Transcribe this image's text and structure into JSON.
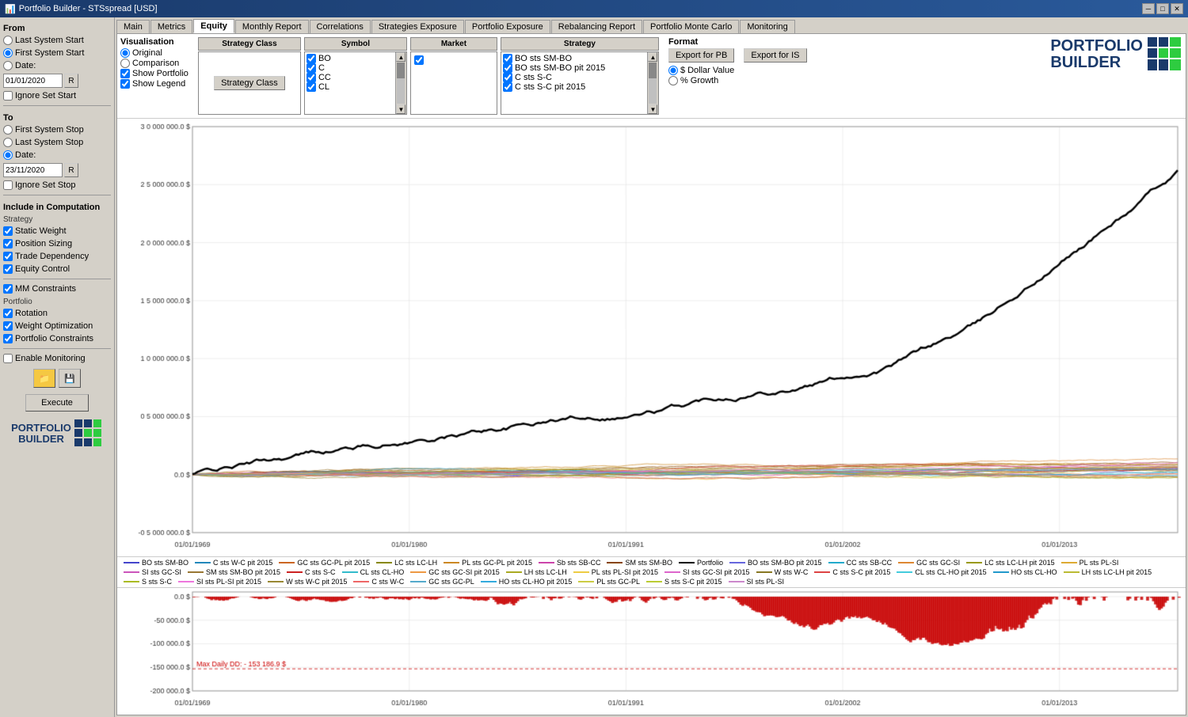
{
  "titleBar": {
    "title": "Portfolio Builder - STSspread [USD]",
    "iconLabel": "pb-icon",
    "controls": [
      "minimize",
      "maximize",
      "close"
    ]
  },
  "tabs": [
    {
      "label": "Main",
      "active": false
    },
    {
      "label": "Metrics",
      "active": false
    },
    {
      "label": "Equity",
      "active": true
    },
    {
      "label": "Monthly Report",
      "active": false
    },
    {
      "label": "Correlations",
      "active": false
    },
    {
      "label": "Strategies Exposure",
      "active": false
    },
    {
      "label": "Portfolio Exposure",
      "active": false
    },
    {
      "label": "Rebalancing Report",
      "active": false
    },
    {
      "label": "Portfolio Monte Carlo",
      "active": false
    },
    {
      "label": "Monitoring",
      "active": false
    }
  ],
  "leftPanel": {
    "fromLabel": "From",
    "fromOptions": [
      {
        "label": "Last System Start",
        "checked": false
      },
      {
        "label": "First System Start",
        "checked": true
      },
      {
        "label": "Date:",
        "checked": false
      }
    ],
    "fromDate": "01/01/2020",
    "ignoreSetStart": "Ignore Set Start",
    "toLabel": "To",
    "toOptions": [
      {
        "label": "First System Stop",
        "checked": false
      },
      {
        "label": "Last System Stop",
        "checked": false
      },
      {
        "label": "Date:",
        "checked": true
      }
    ],
    "toDate": "23/11/2020",
    "ignoreSetStop": "Ignore Set Stop",
    "includeCompLabel": "Include in Computation",
    "strategyLabel": "Strategy",
    "strategyChecks": [
      {
        "label": "Static Weight",
        "checked": true
      },
      {
        "label": "Position Sizing",
        "checked": true
      },
      {
        "label": "Trade Dependency",
        "checked": true
      },
      {
        "label": "Equity Control",
        "checked": true
      }
    ],
    "portfolioLabel": "Portfolio",
    "portfolioChecks": [
      {
        "label": "MM Constraints",
        "checked": true
      },
      {
        "label": "Rotation",
        "checked": true
      },
      {
        "label": "Weight Optimization",
        "checked": true
      },
      {
        "label": "Portfolio Constraints",
        "checked": true
      }
    ],
    "enableMonitoring": "Enable Monitoring",
    "executeLabel": "Execute"
  },
  "visualisation": {
    "title": "Visualisation",
    "radioOptions": [
      {
        "label": "Original",
        "checked": true
      },
      {
        "label": "Comparison",
        "checked": false
      }
    ],
    "checks": [
      {
        "label": "Show Portfolio",
        "checked": true
      },
      {
        "label": "Show Legend",
        "checked": true
      }
    ],
    "strategyClassHeader": "Strategy Class",
    "symbolHeader": "Symbol",
    "symbolItems": [
      "BO",
      "C",
      "CC",
      "CL"
    ],
    "marketHeader": "Market",
    "marketCheck": true,
    "strategyHeader": "Strategy",
    "strategyItems": [
      "BO sts SM-BO",
      "BO sts SM-BO pit 2015",
      "C sts S-C",
      "C sts S-C pit 2015"
    ],
    "format": {
      "title": "Format",
      "options": [
        {
          "label": "$ Dollar Value",
          "checked": true
        },
        {
          "label": "% Growth",
          "checked": false
        }
      ]
    },
    "exportForPB": "Export for PB",
    "exportForIS": "Export for IS"
  },
  "chartYLabels": [
    "3 000 000.0 $",
    "2 500 000.0 $",
    "2 000 000.0 $",
    "1 500 000.0 $",
    "1 000 000.0 $",
    "500 000.0 $",
    "0.0 $",
    "-500 000.0 $"
  ],
  "chartXLabels": [
    "01/01/1969",
    "01/01/1980",
    "01/01/1991",
    "01/01/2002",
    "01/01/2013"
  ],
  "ddYLabels": [
    "0.0 $",
    "-50 000.0 $",
    "-100 000.0 $",
    "-150 000.0 $",
    "-200 000.0 $"
  ],
  "ddXLabels": [
    "01/01/1969",
    "01/01/1980",
    "01/01/1991",
    "01/01/2002",
    "01/01/2013"
  ],
  "maxDailyDD": "Max Daily DD: - 153 186.9 $",
  "legend": [
    {
      "label": "BO sts SM-BO",
      "color": "#4444cc"
    },
    {
      "label": "C sts W-C pit 2015",
      "color": "#2288bb"
    },
    {
      "label": "GC sts GC-PL pit 2015",
      "color": "#cc6622"
    },
    {
      "label": "LC sts LC-LH",
      "color": "#888800"
    },
    {
      "label": "PL sts GC-PL pit 2015",
      "color": "#cc8822"
    },
    {
      "label": "Sb sts SB-CC",
      "color": "#cc44aa"
    },
    {
      "label": "SM sts SM-BO",
      "color": "#884400"
    },
    {
      "label": "Portfolio",
      "color": "#000000"
    },
    {
      "label": "BO sts SM-BO pit 2015",
      "color": "#6666dd"
    },
    {
      "label": "CC sts SB-CC",
      "color": "#22aacc"
    },
    {
      "label": "GC sts GC-SI",
      "color": "#dd8833"
    },
    {
      "label": "LC sts LC-LH pit 2015",
      "color": "#999911"
    },
    {
      "label": "PL sts PL-SI",
      "color": "#ddaa33"
    },
    {
      "label": "SI sts GC-SI",
      "color": "#cc55bb"
    },
    {
      "label": "SM sts SM-BO pit 2015",
      "color": "#997733"
    },
    {
      "label": "C sts S-C",
      "color": "#cc2222"
    },
    {
      "label": "CL sts CL-HO",
      "color": "#33bbcc"
    },
    {
      "label": "GC sts GC-SI pit 2015",
      "color": "#ee9944"
    },
    {
      "label": "LH sts LC-LH",
      "color": "#aaaa22"
    },
    {
      "label": "PL sts PL-SI pit 2015",
      "color": "#eecc44"
    },
    {
      "label": "SI sts GC-SI pit 2015",
      "color": "#dd66cc"
    },
    {
      "label": "W sts W-C",
      "color": "#887722"
    },
    {
      "label": "C sts S-C pit 2015",
      "color": "#dd4444"
    },
    {
      "label": "CL sts CL-HO pit 2015",
      "color": "#44ccdd"
    },
    {
      "label": "HO sts CL-HO",
      "color": "#2299cc"
    },
    {
      "label": "LH sts LC-LH pit 2015",
      "color": "#bbbb33"
    },
    {
      "label": "S sts S-C",
      "color": "#aabb22"
    },
    {
      "label": "SI sts PL-SI pit 2015",
      "color": "#ee77dd"
    },
    {
      "label": "W sts W-C pit 2015",
      "color": "#998833"
    },
    {
      "label": "C sts W-C",
      "color": "#ee6666"
    },
    {
      "label": "GC sts GC-PL",
      "color": "#55aacc"
    },
    {
      "label": "HO sts CL-HO pit 2015",
      "color": "#33aadd"
    },
    {
      "label": "PL sts GC-PL",
      "color": "#cccc44"
    },
    {
      "label": "S sts S-C pit 2015",
      "color": "#bbcc33"
    },
    {
      "label": "SI sts PL-SI",
      "color": "#cc88cc"
    }
  ]
}
